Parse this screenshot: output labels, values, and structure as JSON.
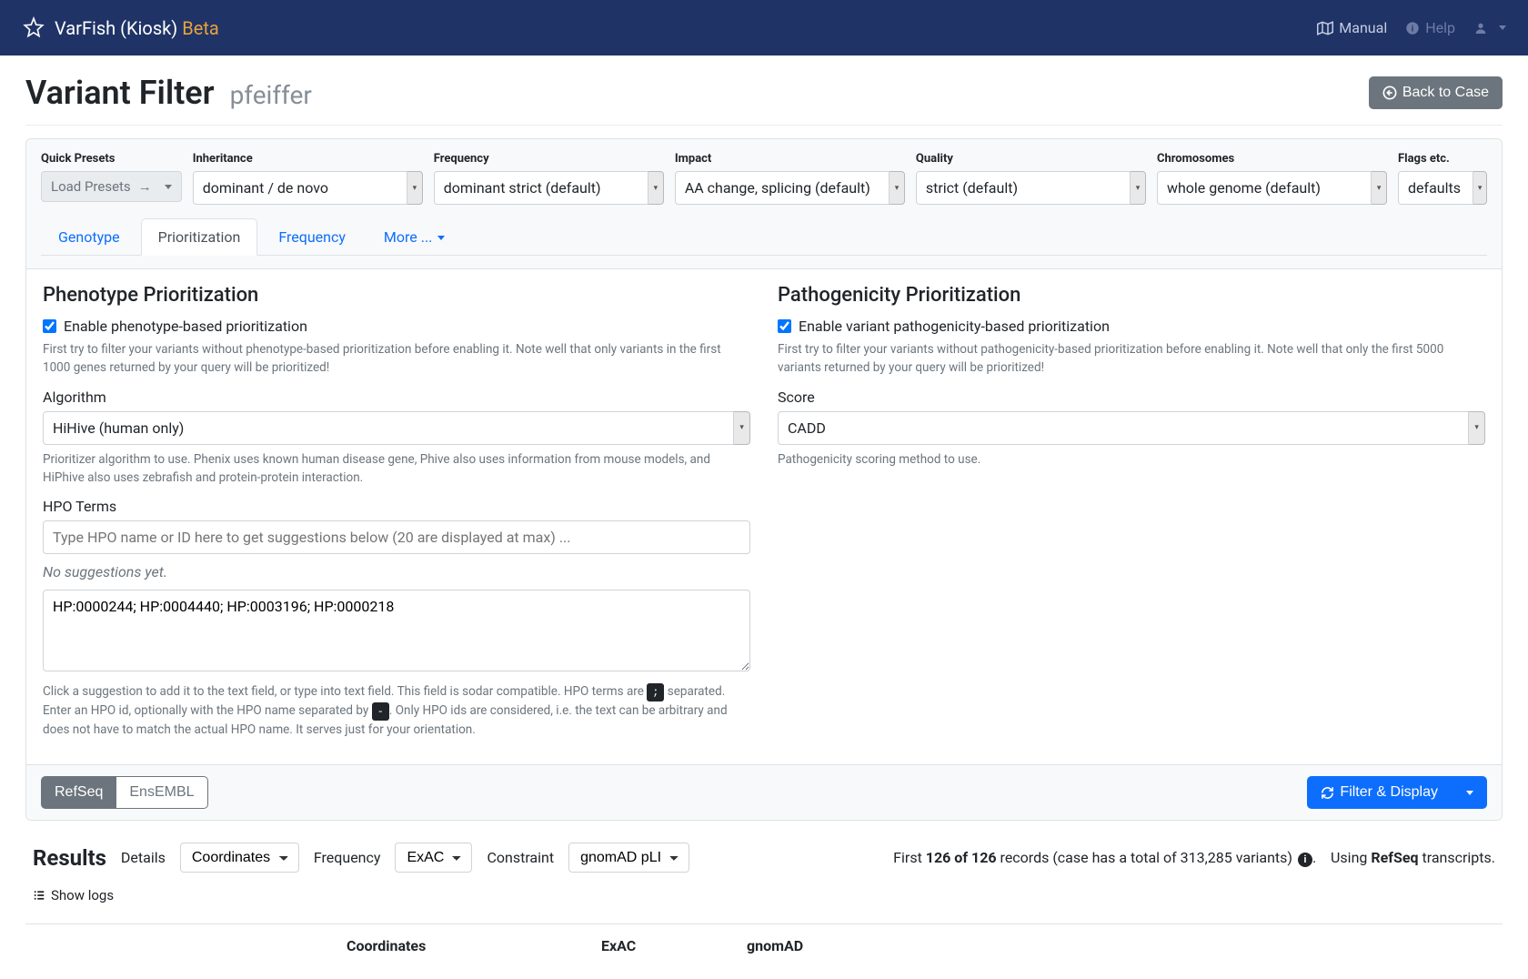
{
  "navbar": {
    "brand_main": "VarFish (Kiosk)",
    "brand_beta": "Beta",
    "manual": "Manual",
    "help": "Help"
  },
  "header": {
    "title": "Variant Filter",
    "subtitle": "pfeiffer",
    "back_button": "Back to Case"
  },
  "presets": {
    "quick_label": "Quick Presets",
    "load_button": "Load Presets",
    "inheritance": {
      "label": "Inheritance",
      "value": "dominant / de novo"
    },
    "frequency": {
      "label": "Frequency",
      "value": "dominant strict (default)"
    },
    "impact": {
      "label": "Impact",
      "value": "AA change, splicing (default)"
    },
    "quality": {
      "label": "Quality",
      "value": "strict (default)"
    },
    "chromosomes": {
      "label": "Chromosomes",
      "value": "whole genome (default)"
    },
    "flags": {
      "label": "Flags etc.",
      "value": "defaults"
    }
  },
  "tabs": {
    "genotype": "Genotype",
    "prioritization": "Prioritization",
    "frequency": "Frequency",
    "more": "More ..."
  },
  "phenotype": {
    "title": "Phenotype Prioritization",
    "enable_label": "Enable phenotype-based prioritization",
    "help1": "First try to filter your variants without phenotype-based prioritization before enabling it. Note well that only variants in the first 1000 genes returned by your query will be prioritized!",
    "algorithm_label": "Algorithm",
    "algorithm_value": "HiHive (human only)",
    "algorithm_help": "Prioritizer algorithm to use. Phenix uses known human disease gene, Phive also uses information from mouse models, and HiPhive also uses zebrafish and protein-protein interaction.",
    "hpo_label": "HPO Terms",
    "hpo_placeholder": "Type HPO name or ID here to get suggestions below (20 are displayed at max) ...",
    "no_suggestions": "No suggestions yet.",
    "hpo_value": "HP:0000244; HP:0004440; HP:0003196; HP:0000218",
    "hpo_help_1": "Click a suggestion to add it to the text field, or type into text field. This field is sodar compatible. HPO terms are ",
    "hpo_help_kbd1": ";",
    "hpo_help_2": " separated. Enter an HPO id, optionally with the HPO name separated by ",
    "hpo_help_kbd2": "-",
    "hpo_help_3": ". Only HPO ids are considered, i.e. the text can be arbitrary and does not have to match the actual HPO name. It serves just for your orientation."
  },
  "pathogenicity": {
    "title": "Pathogenicity Prioritization",
    "enable_label": "Enable variant pathogenicity-based prioritization",
    "help1": "First try to filter your variants without pathogenicity-based prioritization before enabling it. Note well that only the first 5000 variants returned by your query will be prioritized!",
    "score_label": "Score",
    "score_value": "CADD",
    "score_help": "Pathogenicity scoring method to use."
  },
  "footer": {
    "refseq": "RefSeq",
    "ensembl": "EnsEMBL",
    "filter_display": "Filter & Display"
  },
  "results": {
    "title": "Results",
    "details_label": "Details",
    "details_value": "Coordinates",
    "frequency_label": "Frequency",
    "frequency_value": "ExAC",
    "constraint_label": "Constraint",
    "constraint_value": "gnomAD pLI",
    "summary_first": "First ",
    "summary_count": "126 of 126",
    "summary_records": " records (case has a total of 313,285 variants) ",
    "summary_period": ".",
    "using": "   Using ",
    "refseq": "RefSeq",
    "transcripts": " transcripts.",
    "show_logs": "Show logs"
  },
  "table": {
    "coordinates": "Coordinates",
    "exac": "ExAC",
    "gnomad": "gnomAD"
  }
}
